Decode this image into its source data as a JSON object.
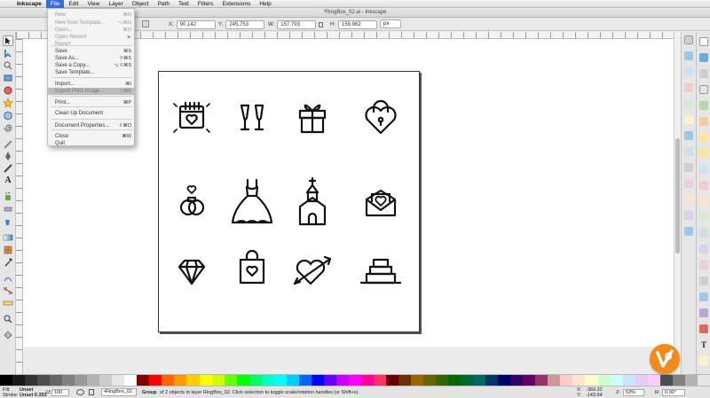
{
  "menubar": {
    "app": "Inkscape",
    "items": [
      "File",
      "Edit",
      "View",
      "Layer",
      "Object",
      "Path",
      "Text",
      "Filters",
      "Extensions",
      "Help"
    ]
  },
  "window": {
    "title": "*RingBox_02.ai - Inkscape"
  },
  "toolctl": {
    "x_label": "X:",
    "x_value": "90.142",
    "y_label": "Y:",
    "y_value": "245.753",
    "w_label": "W:",
    "w_value": "157.793",
    "h_label": "H:",
    "h_value": "159.962",
    "unit": "px"
  },
  "file_menu": {
    "items": [
      {
        "label": "New",
        "shortcut": "⌘N",
        "state": "disabled"
      },
      {
        "label": "New from Template...",
        "shortcut": "⌥⌘N",
        "state": "disabled"
      },
      {
        "label": "Open...",
        "shortcut": "⌘O",
        "state": "disabled"
      },
      {
        "label": "Open Recent",
        "shortcut": "▶",
        "state": "disabled"
      },
      {
        "label": "Revert",
        "shortcut": "",
        "state": "disabled"
      },
      {
        "label": "Save",
        "shortcut": "⌘S",
        "state": "enabled"
      },
      {
        "label": "Save As...",
        "shortcut": "⇧⌘S",
        "state": "enabled"
      },
      {
        "label": "Save a Copy...",
        "shortcut": "⌥⇧⌘S",
        "state": "enabled"
      },
      {
        "label": "Save Template...",
        "shortcut": "",
        "state": "enabled"
      },
      {
        "label": "Import...",
        "shortcut": "⌘I",
        "state": "enabled"
      },
      {
        "label": "Export PNG Image...",
        "shortcut": "⇧⌘E",
        "state": "highlighted"
      },
      {
        "label": "Print...",
        "shortcut": "⌘P",
        "state": "enabled"
      },
      {
        "label": "Clean Up Document",
        "shortcut": "",
        "state": "enabled"
      },
      {
        "label": "Document Properties...",
        "shortcut": "⇧⌘D",
        "state": "enabled"
      },
      {
        "label": "Close",
        "shortcut": "⌘W",
        "state": "enabled"
      },
      {
        "label": "Quit",
        "shortcut": "",
        "state": "enabled"
      }
    ]
  },
  "statusbar": {
    "fill_label": "Fill:",
    "fill_value": "Unset",
    "stroke_label": "Stroke:",
    "stroke_value": "Unset 0.353",
    "opacity_label": "O:",
    "opacity_value": "100",
    "layer": "•RingBox_02",
    "message_bold": "Group",
    "message": "of 2 objects in layer RingBox_02. Click selection to toggle scale/rotation handles (or Shift+s).",
    "x_label": "X:",
    "x_value": "-369.32",
    "y_label": "Y:",
    "y_value": "-143.94",
    "z_label": "Z:",
    "zoom": "53%",
    "r_label": "R:",
    "rotation": "0.00°"
  },
  "icons": [
    "calendar-heart-icon",
    "champagne-glasses-icon",
    "gift-box-icon",
    "heart-padlock-icon",
    "wedding-rings-icon",
    "wedding-dress-icon",
    "chapel-icon",
    "love-letter-icon",
    "diamond-icon",
    "shopping-bag-heart-icon",
    "heart-arrow-icon",
    "wedding-cake-icon"
  ],
  "palette": [
    "#000000",
    "#1a1a1a",
    "#333333",
    "#4d4d4d",
    "#666666",
    "#808080",
    "#999999",
    "#b3b3b3",
    "#cccccc",
    "#e6e6e6",
    "#ffffff",
    "#800000",
    "#ff0000",
    "#ff6600",
    "#ff9900",
    "#ffcc00",
    "#ffff00",
    "#ccff00",
    "#66ff00",
    "#00ff00",
    "#00ff66",
    "#00ffcc",
    "#00ffff",
    "#00ccff",
    "#0066ff",
    "#0000ff",
    "#6600ff",
    "#cc00ff",
    "#ff00ff",
    "#ff0099",
    "#ff3366",
    "#660000",
    "#663300",
    "#996600",
    "#666600",
    "#336600",
    "#006600",
    "#006633",
    "#006666",
    "#003366",
    "#000066",
    "#330066",
    "#660066",
    "#993366",
    "#cc9999",
    "#ffcccc",
    "#ffe5cc",
    "#ffffcc",
    "#ccffcc",
    "#ccffff",
    "#cce5ff",
    "#e5ccff",
    "#ffccff",
    "#4d4d4d",
    "#808080",
    "#b3b3b3",
    "#e6e6e6"
  ],
  "accent": "#f28b1b"
}
